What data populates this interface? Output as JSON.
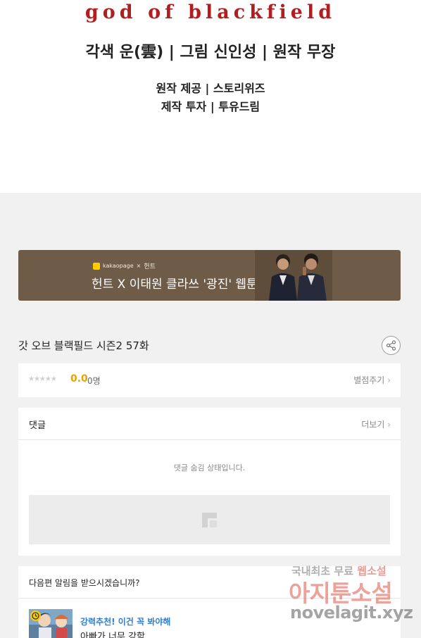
{
  "header": {
    "logo_text": "god of blackfield",
    "credits_main": "각색 운(雲) | 그림 신인성 | 원작 무장",
    "credits_sub_1": "원작 제공 | 스토리위즈",
    "credits_sub_2": "제작 투자 | 투유드림"
  },
  "banner": {
    "brand": "kakaopage",
    "brand_cross": "×",
    "brand_partner": "헌트",
    "text": "헌트 X 이태원 클라쓰 '광진' 웹툰"
  },
  "episode": {
    "title": "갓 오브 블랙필드 시즌2 57화"
  },
  "rating": {
    "stars": "★★★★★",
    "score": "0.0",
    "count": "0명",
    "rate_label": "별점주기"
  },
  "comments": {
    "title": "댓글",
    "more_label": "더보기",
    "hidden_message": "댓글 숨김 상태입니다."
  },
  "notification": {
    "question": "다음편 알림을 받으시겠습니까?",
    "rec_label": "강력추천! 이건 꼭 봐야해",
    "rec_title": "아빠가 너무 강함"
  },
  "watermark": {
    "line1_a": "국내최초 무료",
    "line1_b": "웹소설",
    "line2": "아지툰소설",
    "line3": "novelagit.xyz"
  },
  "colors": {
    "page_bg": "#f1f1f1",
    "logo_red": "#b01f1f",
    "banner_bg": "#6e5c48",
    "score_orange": "#e8a300",
    "rec_blue": "#2f7fd0"
  }
}
